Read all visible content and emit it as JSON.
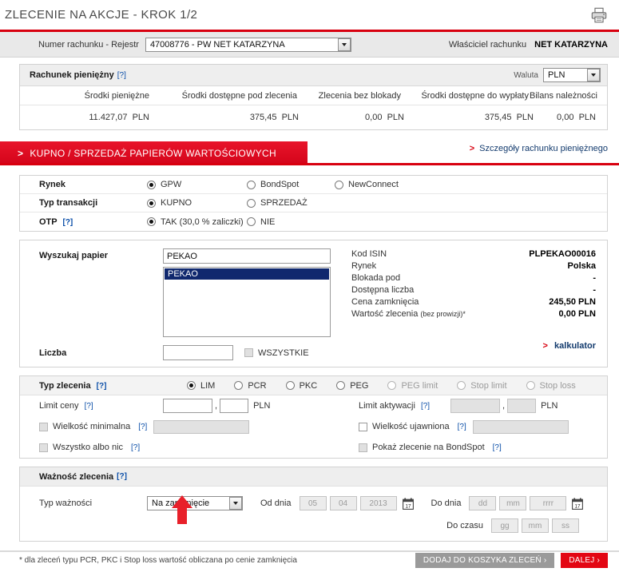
{
  "header": {
    "title": "ZLECENIE NA AKCJE - KROK 1/2",
    "print_icon": "printer-icon"
  },
  "account_bar": {
    "label": "Numer rachunku - Rejestr",
    "selected": "47008776 - PW NET KATARZYNA",
    "owner_label": "Właściciel rachunku",
    "owner_value": "NET KATARZYNA"
  },
  "money_account": {
    "title": "Rachunek pieniężny",
    "help": "[?]",
    "currency_label": "Waluta",
    "currency_value": "PLN",
    "columns": [
      "Środki pieniężne",
      "Środki dostępne pod zlecenia",
      "Zlecenia bez blokady",
      "Środki dostępne do wypłaty",
      "Bilans należności"
    ],
    "values": [
      "11.427,07",
      "375,45",
      "0,00",
      "375,45",
      "0,00"
    ],
    "unit": "PLN"
  },
  "banner": {
    "chevron": ">",
    "label": "KUPNO / SPRZEDAŻ PAPIERÓW WARTOŚCIOWYCH",
    "details_link": "Szczegóły rachunku pieniężnego",
    "details_chevron": ">"
  },
  "market_section": {
    "rows": [
      {
        "label": "Rynek",
        "options": [
          {
            "label": "GPW",
            "selected": true,
            "disabled": false
          },
          {
            "label": "BondSpot",
            "selected": false,
            "disabled": false
          },
          {
            "label": "NewConnect",
            "selected": false,
            "disabled": false
          }
        ]
      },
      {
        "label": "Typ transakcji",
        "options": [
          {
            "label": "KUPNO",
            "selected": true,
            "disabled": false
          },
          {
            "label": "SPRZEDAŻ",
            "selected": false,
            "disabled": false
          }
        ]
      },
      {
        "label": "OTP",
        "help": "[?]",
        "options": [
          {
            "label": "TAK (30,0 % zaliczki)",
            "selected": true,
            "disabled": false
          },
          {
            "label": "NIE",
            "selected": false,
            "disabled": false
          }
        ]
      }
    ]
  },
  "instrument": {
    "search_label": "Wyszukaj papier",
    "search_value": "PEKAO",
    "search_placeholder": "",
    "list_items": [
      "PEKAO"
    ],
    "quantity_label": "Liczba",
    "quantity_value": "",
    "quantity_placeholder": "",
    "all_checkbox_label": "WSZYSTKIE",
    "all_checked": false,
    "details": [
      {
        "key": "Kod ISIN",
        "value": "PLPEKAO00016"
      },
      {
        "key": "Rynek",
        "value": "Polska"
      },
      {
        "key": "Blokada pod",
        "value": "-"
      },
      {
        "key": "Dostępna liczba",
        "value": "-"
      },
      {
        "key": "Cena zamknięcia",
        "value": "245,50 PLN"
      },
      {
        "key": "Wartość zlecenia",
        "key_small": "(bez prowizji)*",
        "value": "0,00 PLN"
      }
    ],
    "calculator_link": "kalkulator",
    "calculator_chevron": ">"
  },
  "order_type": {
    "label": "Typ zlecenia",
    "help": "[?]",
    "options": [
      {
        "label": "LIM",
        "selected": true,
        "disabled": false
      },
      {
        "label": "PCR",
        "selected": false,
        "disabled": false
      },
      {
        "label": "PKC",
        "selected": false,
        "disabled": false
      },
      {
        "label": "PEG",
        "selected": false,
        "disabled": false
      },
      {
        "label": "PEG limit",
        "selected": false,
        "disabled": true
      },
      {
        "label": "Stop limit",
        "selected": false,
        "disabled": true
      },
      {
        "label": "Stop loss",
        "selected": false,
        "disabled": true
      }
    ],
    "price_limit_label": "Limit ceny",
    "price_limit_help": "[?]",
    "price_limit_int": "",
    "price_limit_dec": "",
    "price_limit_unit": "PLN",
    "activation_limit_label": "Limit aktywacji",
    "activation_limit_help": "[?]",
    "activation_limit_int": "",
    "activation_limit_dec": "",
    "activation_limit_unit": "PLN",
    "checkboxes": [
      {
        "label": "Wielkość minimalna",
        "help": "[?]",
        "checked": false,
        "disabled": true,
        "has_field": true
      },
      {
        "label": "Wielkość ujawniona",
        "help": "[?]",
        "checked": false,
        "disabled": false,
        "has_field": true
      },
      {
        "label": "Wszystko albo nic",
        "help": "[?]",
        "checked": false,
        "disabled": true,
        "has_field": false
      },
      {
        "label": "Pokaż zlecenie na BondSpot",
        "help": "[?]",
        "checked": false,
        "disabled": true,
        "has_field": false
      }
    ]
  },
  "validity": {
    "title": "Ważność zlecenia",
    "help": "[?]",
    "type_label": "Typ ważności",
    "type_value": "Na zamknięcie",
    "from_label": "Od dnia",
    "from_day": "05",
    "from_month": "04",
    "from_year": "2013",
    "to_label": "Do dnia",
    "to_day_placeholder": "dd",
    "to_month_placeholder": "mm",
    "to_year_placeholder": "rrrr",
    "time_label": "Do czasu",
    "time_hour_placeholder": "gg",
    "time_min_placeholder": "mm",
    "time_sec_placeholder": "ss",
    "calendar_icon": "calendar-icon"
  },
  "footer": {
    "note": "* dla zleceń typu PCR, PKC i Stop loss wartość obliczana po cenie zamknięcia",
    "basket_button": "DODAJ DO KOSZYKA ZLECEŃ ›",
    "next_button": "DALEJ ›"
  },
  "annotation": {
    "arrow": "red-up-arrow",
    "color": "#e8202a"
  },
  "colors": {
    "brand_red": "#d8000f",
    "banner_red": "#e3051b",
    "link_blue": "#123a6d",
    "select_blue": "#10286e"
  }
}
